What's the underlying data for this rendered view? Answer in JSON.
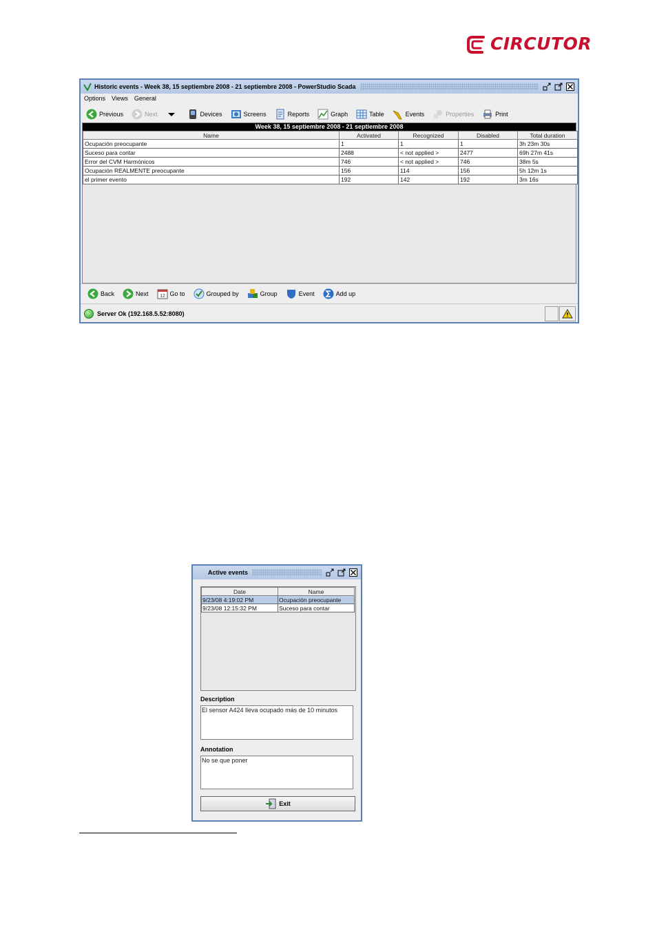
{
  "logo": {
    "text": "CIRCUTOR",
    "color": "#c8102e"
  },
  "main_window": {
    "title": "Historic events - Week 38, 15 septiembre 2008 - 21 septiembre 2008 - PowerStudio Scada",
    "menu": [
      "Options",
      "Views",
      "General"
    ],
    "toolbar": {
      "previous": "Previous",
      "next": "Next",
      "devices": "Devices",
      "screens": "Screens",
      "reports": "Reports",
      "graph": "Graph",
      "table": "Table",
      "events": "Events",
      "properties": "Properties",
      "print": "Print"
    },
    "week_header": "Week 38, 15 septiembre 2008 - 21 septiembre 2008",
    "columns": [
      "Name",
      "Activated",
      "Recognized",
      "Disabled",
      "Total duration"
    ],
    "rows": [
      [
        "Ocupación preocupante",
        "1",
        "1",
        "1",
        "3h 23m 30s"
      ],
      [
        "Suceso para contar",
        "2488",
        "< not applied >",
        "2477",
        "69h 27m 41s"
      ],
      [
        "Error del CVM Harmónicos",
        "746",
        "< not applied >",
        "746",
        "38m 5s"
      ],
      [
        "Ocupación REALMENTE preocupante",
        "156",
        "114",
        "156",
        "5h 12m 1s"
      ],
      [
        "el primer evento",
        "192",
        "142",
        "192",
        "3m 16s"
      ]
    ],
    "bottom": {
      "back": "Back",
      "next": "Next",
      "goto": "Go to",
      "grouped_by": "Grouped by",
      "group": "Group",
      "event": "Event",
      "add_up": "Add up"
    },
    "status": "Server Ok (192.168.5.52:8080)"
  },
  "active_window": {
    "title": "Active events",
    "columns": [
      "Date",
      "Name"
    ],
    "rows": [
      [
        "9/23/08 4:19:02 PM",
        "Ocupación preocupante"
      ],
      [
        "9/23/08 12:15:32 PM",
        "Suceso para contar"
      ]
    ],
    "description_label": "Description",
    "description": "El sensor A424 lleva ocupado más de 10 minutos",
    "annotation_label": "Annotation",
    "annotation": "No se que poner",
    "exit": "Exit"
  }
}
